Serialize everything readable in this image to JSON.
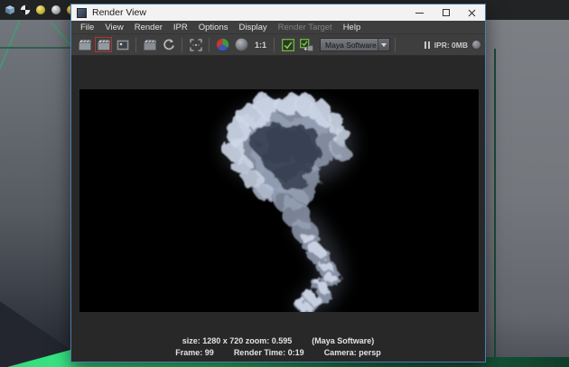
{
  "maya_background": {
    "statusline_icon_names": [
      "texture-cube-icon",
      "render-globe-icon",
      "yellow-sphere-icon",
      "white-sphere-icon",
      "amber-sphere-icon",
      "paint-bucket-icon"
    ]
  },
  "render_view_window": {
    "title": "Render View",
    "window_control_names": [
      "minimize-button",
      "maximize-button",
      "close-button"
    ],
    "menu": {
      "items": [
        {
          "label": "File",
          "enabled": true
        },
        {
          "label": "View",
          "enabled": true
        },
        {
          "label": "Render",
          "enabled": true
        },
        {
          "label": "IPR",
          "enabled": true
        },
        {
          "label": "Options",
          "enabled": true
        },
        {
          "label": "Display",
          "enabled": true
        },
        {
          "label": "Render Target",
          "enabled": false
        },
        {
          "label": "Help",
          "enabled": true
        }
      ]
    },
    "toolbar": {
      "icon_names": [
        "render-current-frame-icon",
        "redo-previous-render-icon",
        "snapshot-icon",
        "ipr-render-icon",
        "refresh-render-icon",
        "render-region-icon",
        "rgb-channels-icon",
        "alpha-channel-icon",
        "one-to-one-icon",
        "keep-image-icon",
        "remove-image-icon",
        "pause-ipr-icon",
        "ipr-memory-icon"
      ],
      "one_to_one_label": "1:1",
      "renderer_dropdown_value": "Maya Software",
      "ipr_memory_label": "IPR: 0MB"
    },
    "render_image": {
      "description": "black render of a white smoke plume",
      "resolution": "1280 x 720"
    },
    "status_bar": {
      "size_zoom": "size: 1280 x 720 zoom: 0.595",
      "renderer": "(Maya Software)",
      "frame": "Frame: 99",
      "render_time": "Render Time: 0:19",
      "camera": "Camera: persp"
    }
  },
  "colors": {
    "titlebar_bg": "#f2f2f2",
    "window_border_accent": "#4a7eb0",
    "panel_bg": "#3e3e3e",
    "content_bg": "#282828",
    "render_bg": "#000000",
    "disabled_menu_text": "#828282",
    "keep_image_green": "#77bb41",
    "viewport_gray": "#74787e",
    "selection_green": "#35e07e",
    "smoke_highlight": "#cdd7e7",
    "smoke_core": "#394153"
  }
}
